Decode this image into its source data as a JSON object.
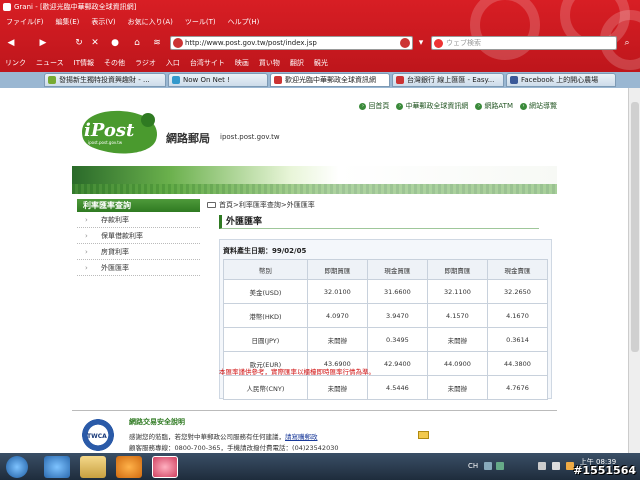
{
  "window": {
    "title": "Grani - [歡迎光臨中華郵政全球資訊網]"
  },
  "menu": [
    "ファイル(F)",
    "編集(E)",
    "表示(V)",
    "お気に入り(A)",
    "ツール(T)",
    "ヘルプ(H)"
  ],
  "address_bar": {
    "url": "http://www.post.gov.tw/post/index.jsp"
  },
  "search_bar": {
    "placeholder": "ウェブ検索"
  },
  "bookmarks": [
    "リンク",
    "ニュース",
    "IT情報",
    "その他",
    "ラジオ",
    "入口",
    "台湾サイト",
    "映画",
    "買い物",
    "翻訳",
    "観光"
  ],
  "tabs": [
    {
      "label": "發揚新生獨特投資興趣財 - ...",
      "active": false
    },
    {
      "label": "Now On Net !",
      "active": false
    },
    {
      "label": "歡迎光臨中華郵政全球資訊網",
      "active": true
    },
    {
      "label": "台灣銀行 線上匯匯 - Easy...",
      "active": false
    },
    {
      "label": "Facebook 上的開心農場",
      "active": false
    }
  ],
  "site": {
    "logo_text": "iPost",
    "logo_subtext": "ipost.post.gov.tw",
    "name": "網路郵局",
    "domain": "ipost.post.gov.tw",
    "toplinks": [
      "回首頁",
      "中華郵政全球資訊網",
      "網路ATM",
      "網站導覽"
    ]
  },
  "sidebar": {
    "title": "利率匯率查詢",
    "items": [
      "存款利率",
      "保單借款利率",
      "房貸利率",
      "外匯匯率"
    ]
  },
  "content": {
    "breadcrumb": "首頁>利率匯率查詢>外匯匯率",
    "title": "外匯匯率",
    "date_label": "資料產生日期：99/02/05",
    "table_headers": [
      "幣別",
      "即期買匯",
      "現金買匯",
      "即期賣匯",
      "現金賣匯"
    ],
    "rows": [
      [
        "美金(USD)",
        "32.0100",
        "31.6600",
        "32.1100",
        "32.2650"
      ],
      [
        "港幣(HKD)",
        "4.0970",
        "3.9470",
        "4.1570",
        "4.1670"
      ],
      [
        "日圓(JPY)",
        "未開辦",
        "0.3495",
        "未開辦",
        "0.3614"
      ],
      [
        "歐元(EUR)",
        "43.6900",
        "42.9400",
        "44.0900",
        "44.3800"
      ],
      [
        "人民幣(CNY)",
        "未開辦",
        "4.5446",
        "未開辦",
        "4.7676"
      ]
    ],
    "note": "本匯率謹供參考，實際匯率以櫃檯即時匯率行情為準。"
  },
  "footer": {
    "badge": "TWCA",
    "title": "網路交易安全說明",
    "line1": "感謝您的蒞臨，若您對中華郵政公司服務有任何建議，",
    "line1_link": "請寫購郵政",
    "line2": "顧客服務專線：0800-700-365，手機請改撥付費電話：(04)23542030"
  },
  "taskbar": {
    "lang": "CH",
    "time": "上午 08:39"
  },
  "watermark": "#1551564"
}
